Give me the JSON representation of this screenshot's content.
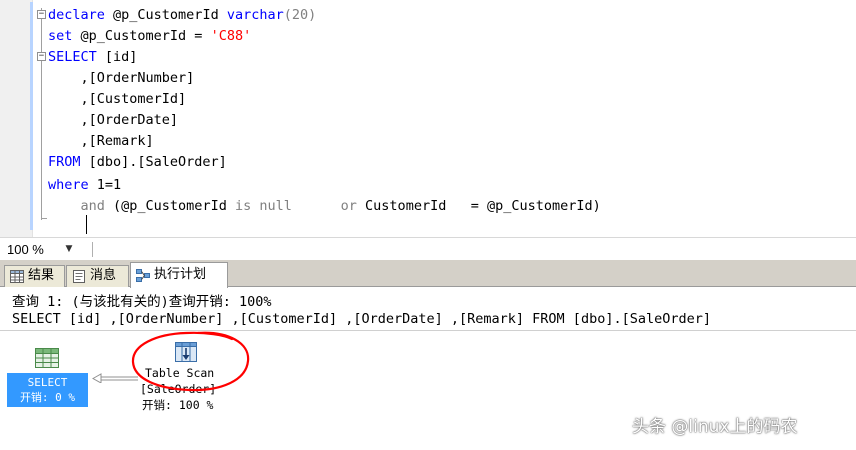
{
  "editor": {
    "lines": {
      "l1": {
        "kw": "declare",
        "rest": " @p_CustomerId ",
        "type": "varchar",
        "size": "(20)"
      },
      "l2": {
        "kw": "set",
        "rest": " @p_CustomerId = ",
        "str": "'C88'"
      },
      "l3": {
        "kw": "SELECT",
        "rest": " [id]"
      },
      "l4": {
        "rest": "    ,[OrderNumber]"
      },
      "l5": {
        "rest": "    ,[CustomerId]"
      },
      "l6": {
        "rest": "    ,[OrderDate]"
      },
      "l7": {
        "rest": "    ,[Remark]"
      },
      "l8": {
        "kw": "FROM",
        "rest": " [dbo].[SaleOrder]"
      },
      "l9": {
        "kw": "where",
        "rest": " 1=1"
      },
      "l10": {
        "pre": "    ",
        "and": "and",
        "p1": " (@p_CustomerId ",
        "is": "is",
        "sp": " ",
        "null": "null",
        "sp2": "      ",
        "or": "or",
        "p2": " CustomerId   = @p_CustomerId)"
      }
    }
  },
  "zoom": {
    "value": "100 %"
  },
  "tabs": {
    "results": "结果",
    "messages": "消息",
    "plan": "执行计划"
  },
  "plan": {
    "query_line": "查询 1: (与该批有关的)查询开销: 100%",
    "sql_line": "SELECT [id] ,[OrderNumber] ,[CustomerId] ,[OrderDate] ,[Remark] FROM [dbo].[SaleOrder]",
    "select_node": {
      "name": "SELECT",
      "cost": "开销: 0 %"
    },
    "scan_node": {
      "name": "Table Scan",
      "table": "[SaleOrder]",
      "cost": "开销: 100 %"
    }
  },
  "colors": {
    "keyword": "#0000ff",
    "string": "#ff0000",
    "grey_op": "#808080",
    "selected_node": "#3399ff",
    "annotation_circle": "#ff0000"
  },
  "watermark": "头条 @linux上的码农"
}
